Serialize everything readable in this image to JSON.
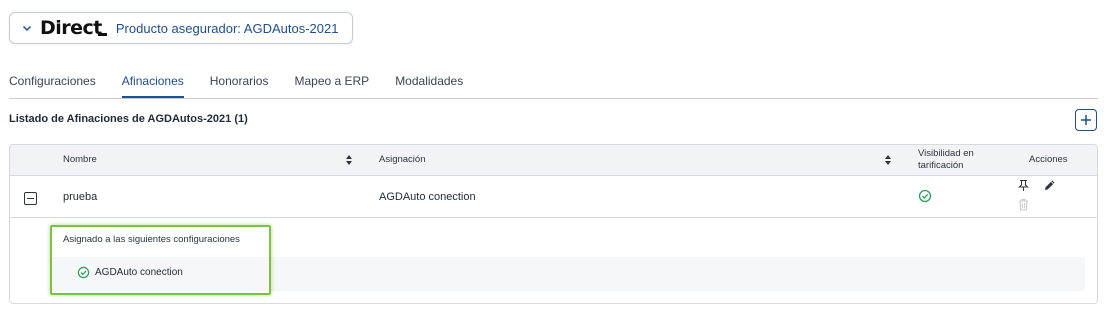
{
  "header": {
    "logo_text": "Direct",
    "product_label": "Producto asegurador: AGDAutos-2021"
  },
  "tabs": [
    {
      "label": "Configuraciones",
      "active": false
    },
    {
      "label": "Afinaciones",
      "active": true
    },
    {
      "label": "Honorarios",
      "active": false
    },
    {
      "label": "Mapeo a ERP",
      "active": false
    },
    {
      "label": "Modalidades",
      "active": false
    }
  ],
  "list": {
    "title": "Listado de Afinaciones de AGDAutos-2021 (1)"
  },
  "table": {
    "headers": {
      "nombre": "Nombre",
      "asignacion": "Asignación",
      "visibilidad_line1": "Visibilidad en",
      "visibilidad_line2": "tarificación",
      "acciones": "Acciones"
    },
    "rows": [
      {
        "nombre": "prueba",
        "asignacion": "AGDAuto conection",
        "visible": true
      }
    ]
  },
  "expanded": {
    "title": "Asignado a las siguientes configuraciones",
    "items": [
      "AGDAuto conection"
    ]
  },
  "colors": {
    "primary": "#1f4e8c",
    "success": "#2e9e5b",
    "highlight": "#7cc242",
    "muted_icon": "#c4c8ce"
  },
  "icons": {
    "chevron": "chevron-down-icon",
    "add": "plus-icon",
    "sort": "sort-icon",
    "collapse": "minus-square-icon",
    "check": "check-circle-icon",
    "pin": "pin-icon",
    "edit": "pencil-icon",
    "delete": "trash-icon"
  }
}
